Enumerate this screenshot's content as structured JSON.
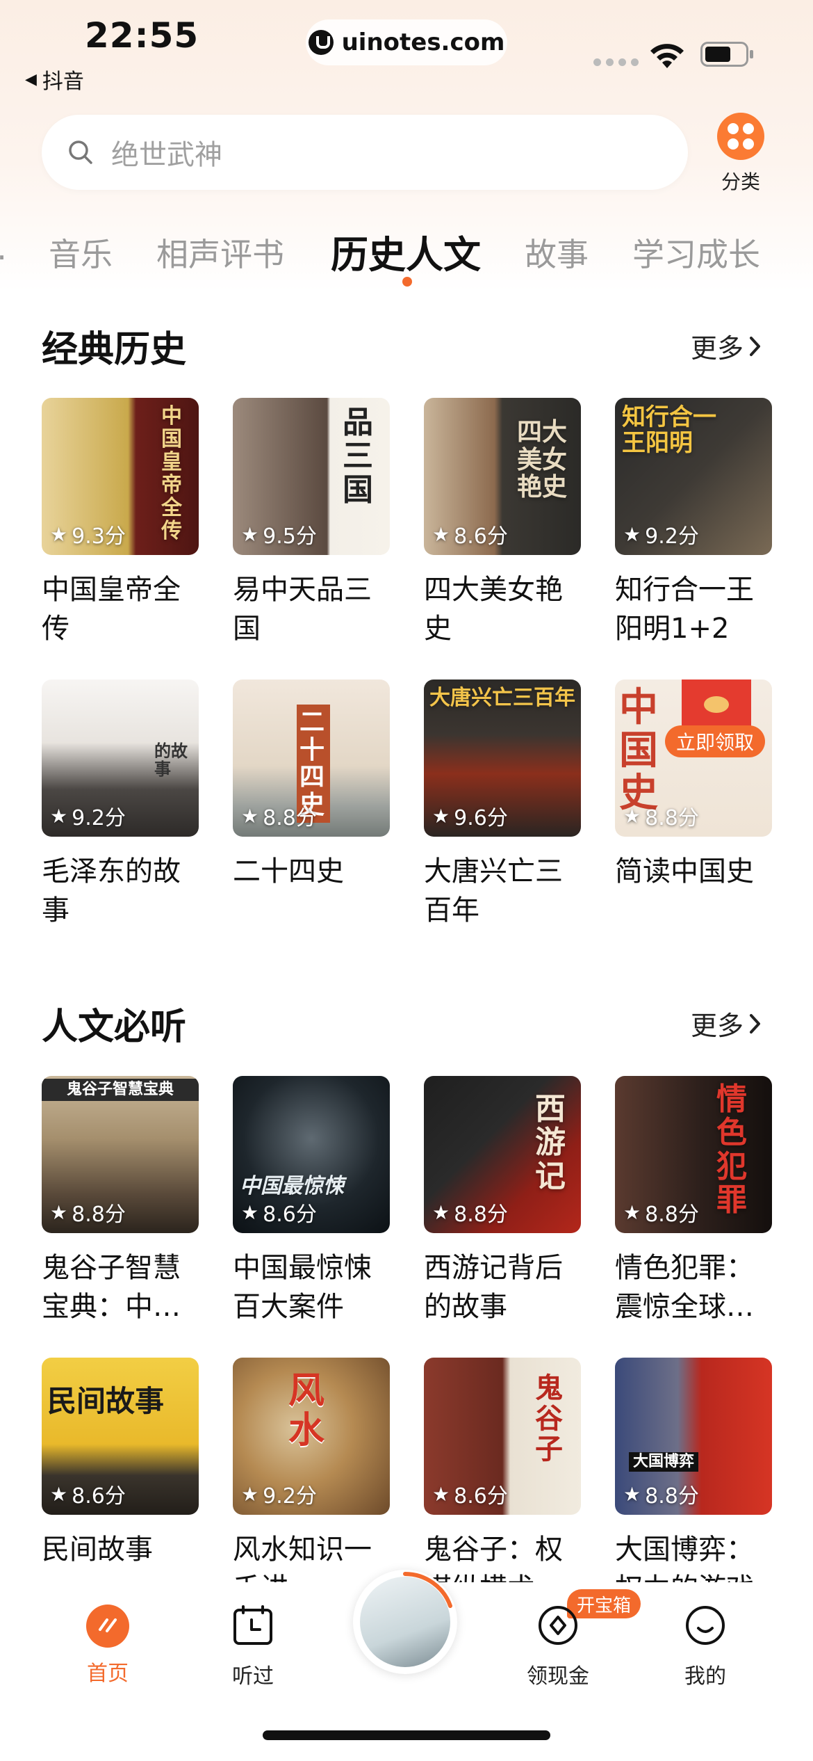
{
  "status": {
    "time": "22:55",
    "back_app": "抖音",
    "url": "uinotes.com"
  },
  "search": {
    "placeholder": "绝世武神"
  },
  "category_button": {
    "label": "分类"
  },
  "tabs": [
    {
      "label": "音乐",
      "active": false
    },
    {
      "label": "相声评书",
      "active": false
    },
    {
      "label": "历史人文",
      "active": true
    },
    {
      "label": "故事",
      "active": false
    },
    {
      "label": "学习成长",
      "active": false
    }
  ],
  "sections": [
    {
      "title": "经典历史",
      "more": "更多",
      "items": [
        {
          "title": "中国皇帝全传",
          "rating": "9.3分",
          "cover_text": "中国皇帝全传"
        },
        {
          "title": "易中天品三国",
          "rating": "9.5分",
          "cover_text": "品三国"
        },
        {
          "title": "四大美女艳史",
          "rating": "8.6分",
          "cover_text": "四大美女艳史"
        },
        {
          "title": "知行合一王阳明1+2",
          "rating": "9.2分",
          "cover_text": "知行合一王阳明"
        },
        {
          "title": "毛泽东的故事",
          "rating": "9.2分",
          "cover_text": "的故事"
        },
        {
          "title": "二十四史",
          "rating": "8.8分",
          "cover_text": "二十四史"
        },
        {
          "title": "大唐兴亡三百年",
          "rating": "9.6分",
          "cover_text": "大唐兴亡三百年"
        },
        {
          "title": "简读中国史",
          "rating": "8.8分",
          "cover_text": "中国史",
          "promo": "立即领取"
        }
      ]
    },
    {
      "title": "人文必听",
      "more": "更多",
      "items": [
        {
          "title": "鬼谷子智慧宝典：中…",
          "rating": "8.8分",
          "cover_text": "鬼谷子智慧宝典"
        },
        {
          "title": "中国最惊悚百大案件",
          "rating": "8.6分",
          "cover_text": "中国最惊悚"
        },
        {
          "title": "西游记背后的故事",
          "rating": "8.8分",
          "cover_text": "西游记"
        },
        {
          "title": "情色犯罪：震惊全球…",
          "rating": "8.8分",
          "cover_text": "情色犯罪"
        },
        {
          "title": "民间故事",
          "rating": "8.6分",
          "cover_text": "民间故事"
        },
        {
          "title": "风水知识一千讲",
          "rating": "9.2分",
          "cover_text": "风水"
        },
        {
          "title": "鬼谷子：权谋纵横术",
          "rating": "8.6分",
          "cover_text": "鬼谷子"
        },
        {
          "title": "大国博弈：权力的游戏",
          "rating": "8.8分",
          "cover_text": "大国博弈"
        }
      ]
    }
  ],
  "tabbar": {
    "home": "首页",
    "history": "听过",
    "cash": "领现金",
    "cash_badge": "开宝箱",
    "me": "我的"
  },
  "colors": {
    "accent": "#f36a2c",
    "header_gradient_top": "#fbeee4"
  }
}
